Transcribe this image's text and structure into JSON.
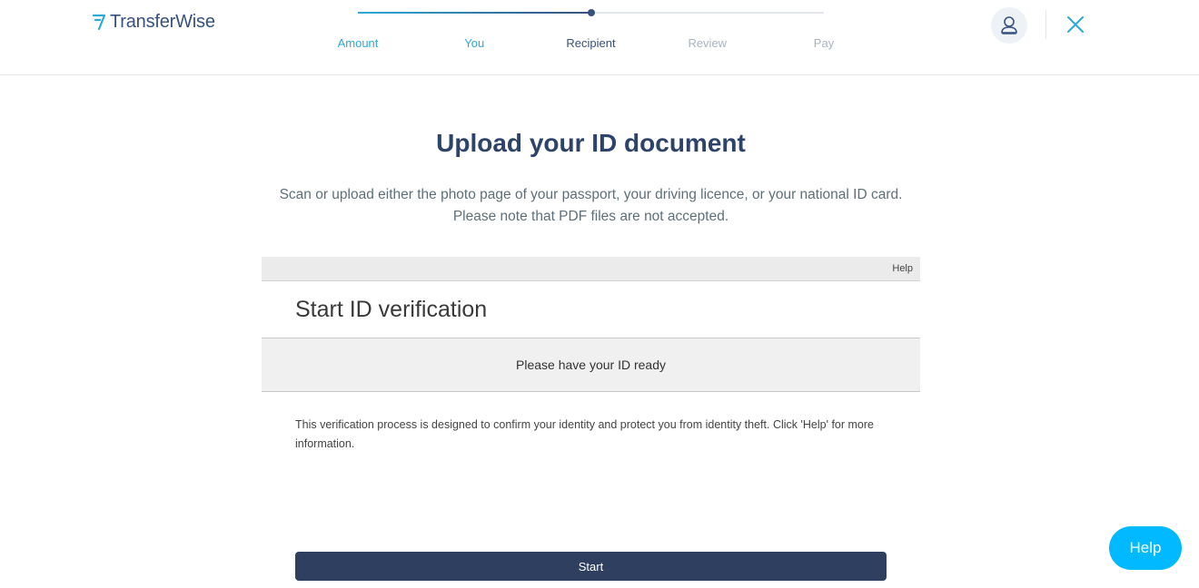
{
  "header": {
    "logo_text": "TransferWise",
    "steps": [
      {
        "label": "Amount",
        "state": "done"
      },
      {
        "label": "You",
        "state": "done"
      },
      {
        "label": "Recipient",
        "state": "current"
      },
      {
        "label": "Review",
        "state": "todo"
      },
      {
        "label": "Pay",
        "state": "todo"
      }
    ],
    "progress_fraction": 0.5
  },
  "main": {
    "title": "Upload your ID document",
    "description": "Scan or upload either the photo page of your passport, your driving licence, or your national ID card. Please note that PDF files are not accepted."
  },
  "verification": {
    "help_link": "Help",
    "title": "Start ID verification",
    "band_text": "Please have your ID ready",
    "info_text": "This verification process is designed to confirm your identity and protect you from identity theft. Click 'Help' for more information.",
    "start_label": "Start"
  },
  "help_fab": {
    "label": "Help"
  },
  "colors": {
    "brand_navy": "#37517e",
    "brand_blue": "#2ea9d8",
    "help_blue": "#00b9ff",
    "start_button": "#2f3f5f"
  },
  "icons": {
    "logo": "transferwise-flag-icon",
    "account": "user-avatar-icon",
    "close": "close-icon"
  }
}
